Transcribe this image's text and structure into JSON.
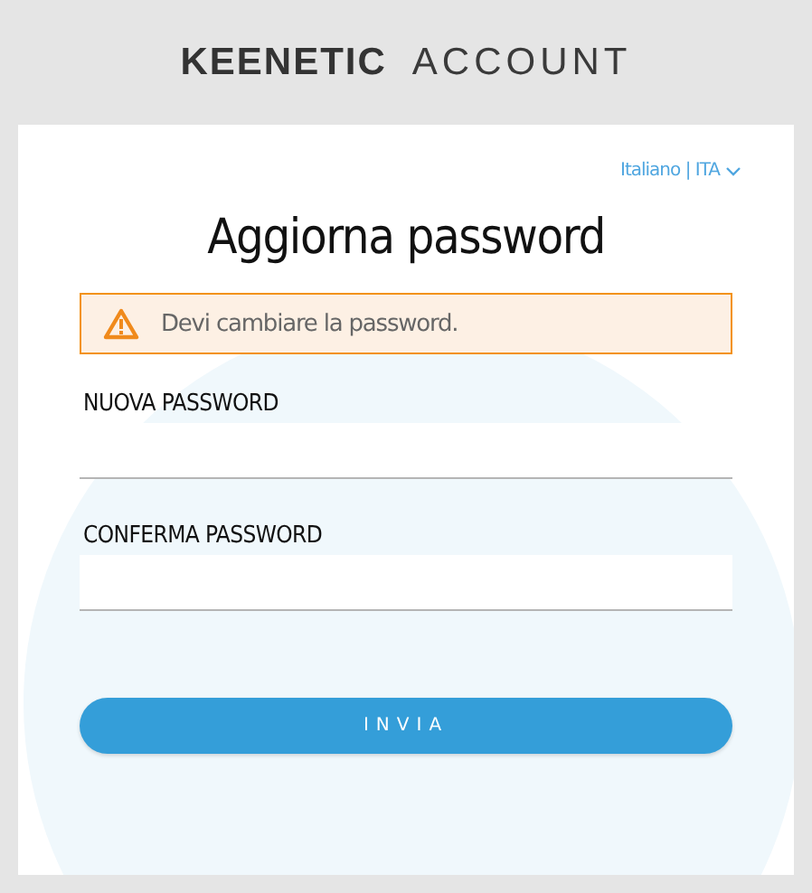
{
  "logo": {
    "brand": "KEENETIC",
    "product": "ACCOUNT"
  },
  "language": "Italiano | ITA",
  "title": "Aggiorna password",
  "alert": {
    "kind": "warning",
    "message": "Devi cambiare la password."
  },
  "fields": [
    {
      "label": "NUOVA PASSWORD"
    },
    {
      "label": "CONFERMA PASSWORD"
    }
  ],
  "submit_button": "INVIA"
}
